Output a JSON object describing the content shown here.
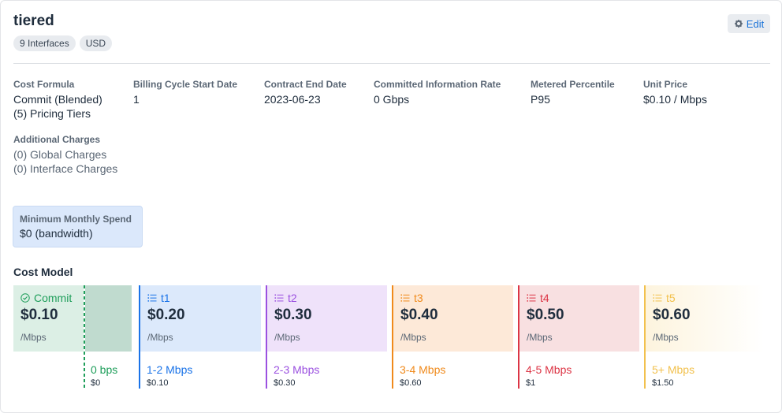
{
  "header": {
    "title": "tiered",
    "tags": [
      "9 Interfaces",
      "USD"
    ],
    "edit_label": "Edit",
    "edit_icon": "gear-icon"
  },
  "fields": {
    "cost_formula": {
      "label": "Cost Formula",
      "value": "Commit (Blended)",
      "value2": "(5) Pricing Tiers"
    },
    "billing_cycle": {
      "label": "Billing Cycle Start Date",
      "value": "1"
    },
    "contract_end": {
      "label": "Contract End Date",
      "value": "2023-06-23"
    },
    "cir": {
      "label": "Committed Information Rate",
      "value": "0 Gbps"
    },
    "metered_percentile": {
      "label": "Metered Percentile",
      "value": "P95"
    },
    "unit_price": {
      "label": "Unit Price",
      "value": "$0.10 / Mbps"
    },
    "additional_charges": {
      "label": "Additional Charges",
      "global": "(0) Global Charges",
      "interface": "(0) Interface Charges"
    }
  },
  "minimum_monthly_spend": {
    "label": "Minimum Monthly Spend",
    "value": "$0 (bandwidth)"
  },
  "cost_model": {
    "title": "Cost Model",
    "commit": {
      "label": "Commit",
      "icon": "check-circle-icon",
      "price": "$0.10",
      "unit": "/Mbps",
      "range": "0 bps",
      "cost": "$0",
      "color": "#1e9e5a"
    },
    "tiers": [
      {
        "label": "t1",
        "icon": "list-icon",
        "price": "$0.20",
        "unit": "/Mbps",
        "range": "1-2 Mbps",
        "cost": "$0.10",
        "color": "#1a73e8",
        "bg": "#dce9fb"
      },
      {
        "label": "t2",
        "icon": "list-icon",
        "price": "$0.30",
        "unit": "/Mbps",
        "range": "2-3 Mbps",
        "cost": "$0.30",
        "color": "#9b51e0",
        "bg": "#efe2fa"
      },
      {
        "label": "t3",
        "icon": "list-icon",
        "price": "$0.40",
        "unit": "/Mbps",
        "range": "3-4 Mbps",
        "cost": "$0.60",
        "color": "#f08a1c",
        "bg": "#fde9d8"
      },
      {
        "label": "t4",
        "icon": "list-icon",
        "price": "$0.50",
        "unit": "/Mbps",
        "range": "4-5 Mbps",
        "cost": "$1",
        "color": "#dc3545",
        "bg": "#f8e0e1"
      },
      {
        "label": "t5",
        "icon": "list-icon",
        "price": "$0.60",
        "unit": "/Mbps",
        "range": "5+ Mbps",
        "cost": "$1.50",
        "color": "#f2c14e",
        "bg": "#fdf4de"
      }
    ]
  }
}
